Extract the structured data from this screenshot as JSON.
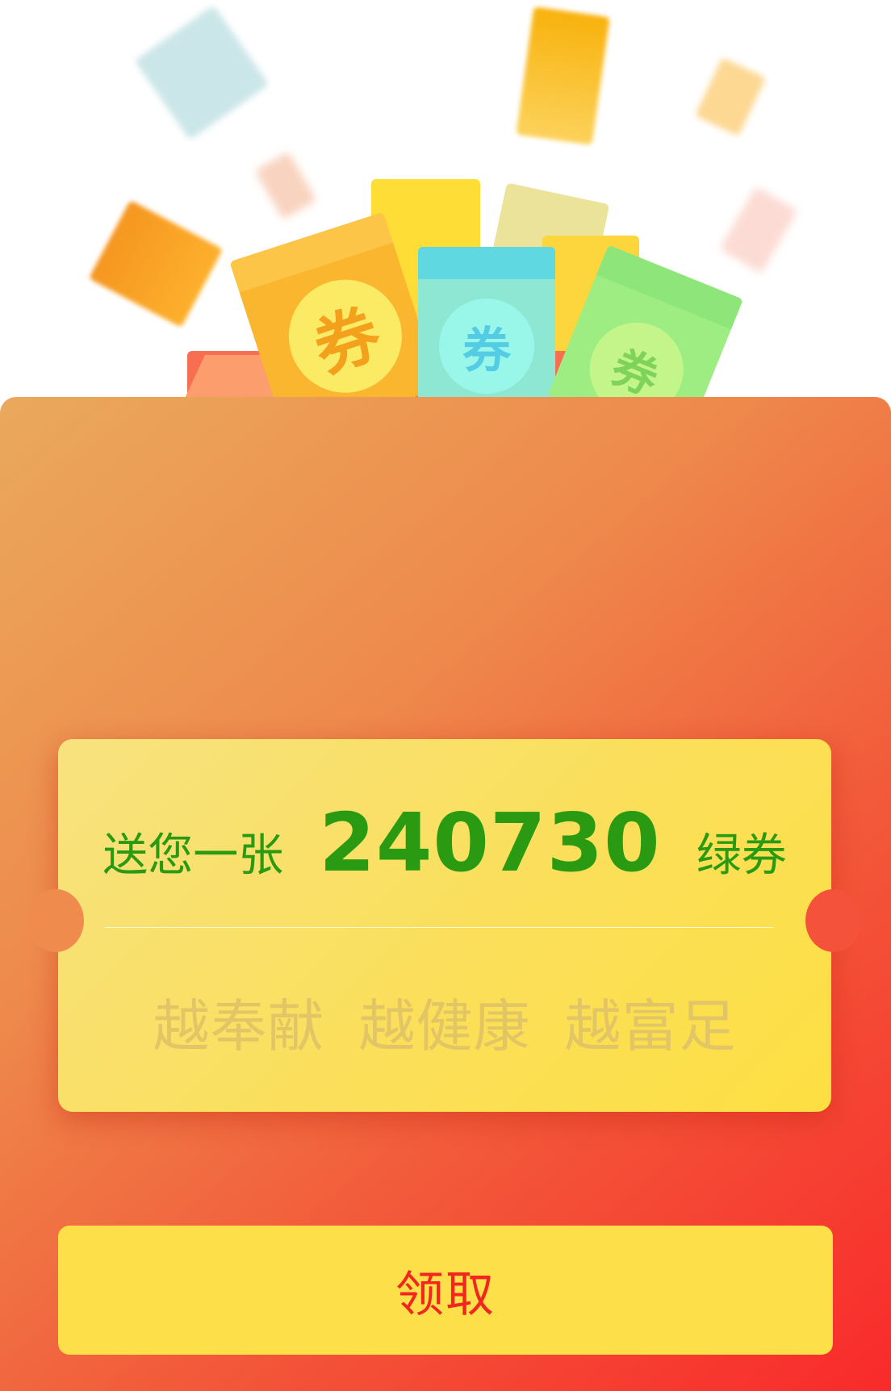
{
  "illustration": {
    "coupon_glyph": "券",
    "currency_glyph": "¥",
    "envelope_colors": {
      "orange": "#fbb630",
      "teal": "#8ee7d3",
      "green": "#9ded82",
      "yellow": "#fdd63d",
      "cream": "#ece39a"
    }
  },
  "ticket": {
    "prefix": "送您一张",
    "amount": "240730",
    "suffix": "绿券",
    "slogans": [
      "越奉献",
      "越健康",
      "越富足"
    ]
  },
  "claim_button": {
    "label": "领取"
  },
  "colors": {
    "card_gradient_start": "#eaa95c",
    "card_gradient_end": "#f92a2b",
    "ticket_yellow": "#fbdf5a",
    "headline_green": "#2a9a12",
    "slogan_gold": "#e2c565",
    "button_yellow": "#fddf4a",
    "button_text_red": "#f2251f"
  }
}
